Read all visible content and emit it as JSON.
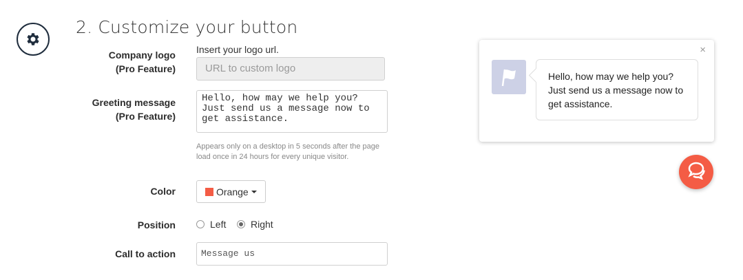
{
  "section": {
    "title": "2. Customize your button",
    "icon": "gear-icon"
  },
  "company_logo": {
    "label_line1": "Company logo",
    "label_line2": "(Pro Feature)",
    "hint": "Insert your logo url.",
    "placeholder": "URL to custom logo"
  },
  "greeting": {
    "label_line1": "Greeting message",
    "label_line2": "(Pro Feature)",
    "value": "Hello, how may we help you?\nJust send us a message now to\nget assistance.",
    "note": "Appears only on a desktop in 5 seconds after the page load once in 24 hours for every unique visitor."
  },
  "color": {
    "label": "Color",
    "selected": "Orange",
    "swatch": "#f45c45"
  },
  "position": {
    "label": "Position",
    "options": [
      "Left",
      "Right"
    ],
    "selected": "Right"
  },
  "call_to_action": {
    "label": "Call to action",
    "value": "Message us"
  },
  "preview": {
    "close_glyph": "×",
    "message_line1": "Hello, how may we help you?",
    "message_line2": "Just send us a message now to",
    "message_line3": "get assistance.",
    "logo_icon": "flag-icon",
    "button_icon": "chat-bubbles-icon",
    "accent": "#f45c45"
  }
}
